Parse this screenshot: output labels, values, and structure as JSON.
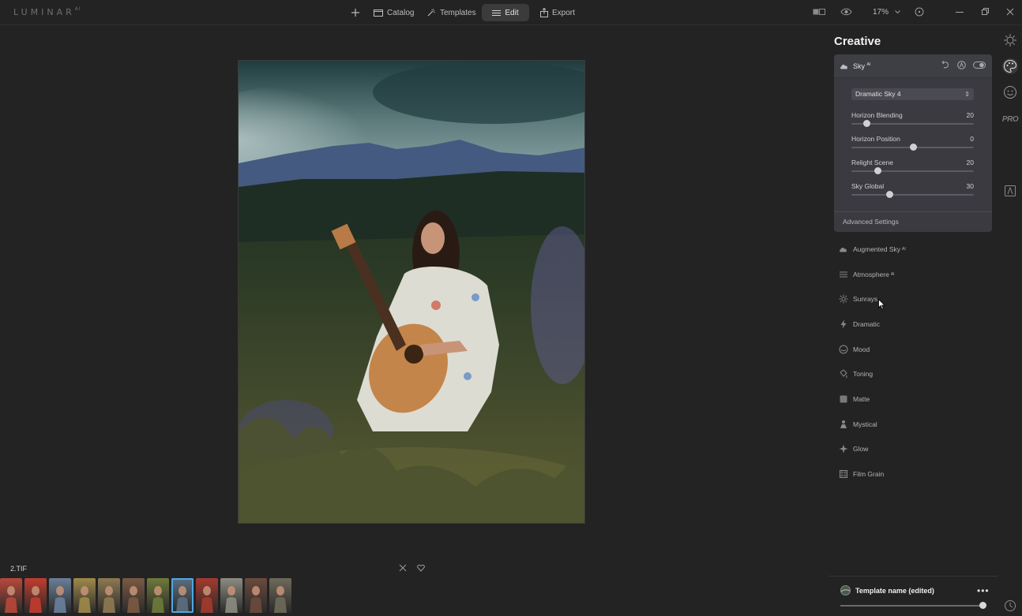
{
  "app": {
    "logo_text": "LUMINAR",
    "logo_superscript": "AI"
  },
  "topnav": {
    "catalog": "Catalog",
    "templates": "Templates",
    "edit": "Edit",
    "export": "Export",
    "zoom": "17%"
  },
  "filmstrip": {
    "filename": "2.TIF",
    "selected_index": 7,
    "thumb_colors": [
      "#b9483a",
      "#c23c2e",
      "#6a7f9a",
      "#9f8a4a",
      "#8e7a52",
      "#7a5a44",
      "#6e7a3a",
      "#5b7080",
      "#a53a2e",
      "#8c8c82",
      "#6c4a3e",
      "#6f6a5a"
    ]
  },
  "panel": {
    "title": "Creative",
    "sky": {
      "label": "Sky",
      "label_sup": "AI",
      "preset": "Dramatic Sky 4",
      "sliders": [
        {
          "label": "Horizon Blending",
          "value": "20",
          "fraction": 0.12
        },
        {
          "label": "Horizon Position",
          "value": "0",
          "fraction": 0.5
        },
        {
          "label": "Relight Scene",
          "value": "20",
          "fraction": 0.21
        },
        {
          "label": "Sky Global",
          "value": "30",
          "fraction": 0.31
        }
      ],
      "advanced": "Advanced Settings"
    },
    "tools": [
      {
        "label": "Augmented Sky",
        "sup": "AI",
        "icon": "cloud-icon"
      },
      {
        "label": "Atmosphere",
        "sup": "AI",
        "icon": "atmosphere-icon"
      },
      {
        "label": "Sunrays",
        "sup": "",
        "icon": "sun-icon"
      },
      {
        "label": "Dramatic",
        "sup": "",
        "icon": "lightning-icon"
      },
      {
        "label": "Mood",
        "sup": "",
        "icon": "mood-icon"
      },
      {
        "label": "Toning",
        "sup": "",
        "icon": "bucket-icon"
      },
      {
        "label": "Matte",
        "sup": "",
        "icon": "square-icon"
      },
      {
        "label": "Mystical",
        "sup": "",
        "icon": "mystical-icon"
      },
      {
        "label": "Glow",
        "sup": "",
        "icon": "glow-icon"
      },
      {
        "label": "Film Grain",
        "sup": "",
        "icon": "film-grain-icon"
      }
    ],
    "rail": {
      "pro": "PRO"
    }
  },
  "template": {
    "name": "Template name (edited)",
    "more": "•••",
    "amount": 1.0
  },
  "colors": {
    "accent": "#4fa6e6",
    "panel_card": "#3a3a40",
    "background": "#232323"
  }
}
